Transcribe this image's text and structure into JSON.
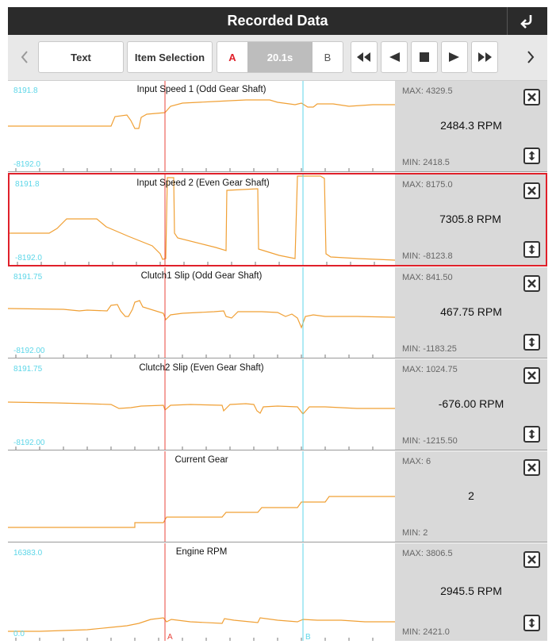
{
  "header": {
    "title": "Recorded Data"
  },
  "toolbar": {
    "text_label": "Text",
    "item_selection_label": "Item Selection",
    "marker_a": "A",
    "time": "20.1s",
    "marker_b": "B"
  },
  "panels": [
    {
      "title": "Input Speed 1 (Odd Gear Shaft)",
      "ymax": "8191.8",
      "ymin": "-8192.0",
      "max": "MAX: 4329.5",
      "min": "MIN: 2418.5",
      "value": "2484.3 RPM"
    },
    {
      "title": "Input Speed 2 (Even Gear Shaft)",
      "ymax": "8191.8",
      "ymin": "-8192.0",
      "max": "MAX: 8175.0",
      "min": "MIN: -8123.8",
      "value": "7305.8 RPM"
    },
    {
      "title": "Clutch1 Slip (Odd Gear Shaft)",
      "ymax": "8191.75",
      "ymin": "-8192.00",
      "max": "MAX: 841.50",
      "min": "MIN: -1183.25",
      "value": "467.75 RPM"
    },
    {
      "title": "Clutch2 Slip (Even Gear Shaft)",
      "ymax": "8191.75",
      "ymin": "-8192.00",
      "max": "MAX: 1024.75",
      "min": "MIN: -1215.50",
      "value": "-676.00 RPM"
    },
    {
      "title": "Current Gear",
      "ymax": "",
      "ymin": "",
      "max": "MAX: 6",
      "min": "MIN: 2",
      "value": "2"
    },
    {
      "title": "Engine RPM",
      "ymax": "16383.0",
      "ymin": "0.0",
      "max": "MAX: 3806.5",
      "min": "MIN: 2421.0",
      "value": "2945.5 RPM"
    }
  ],
  "cursor_labels": {
    "a": "A",
    "b": "B"
  },
  "colors": {
    "trace": "#f0a035",
    "cursor_a": "#e8453c",
    "cursor_b": "#5cd6e8",
    "selected_border": "#e0202a"
  }
}
